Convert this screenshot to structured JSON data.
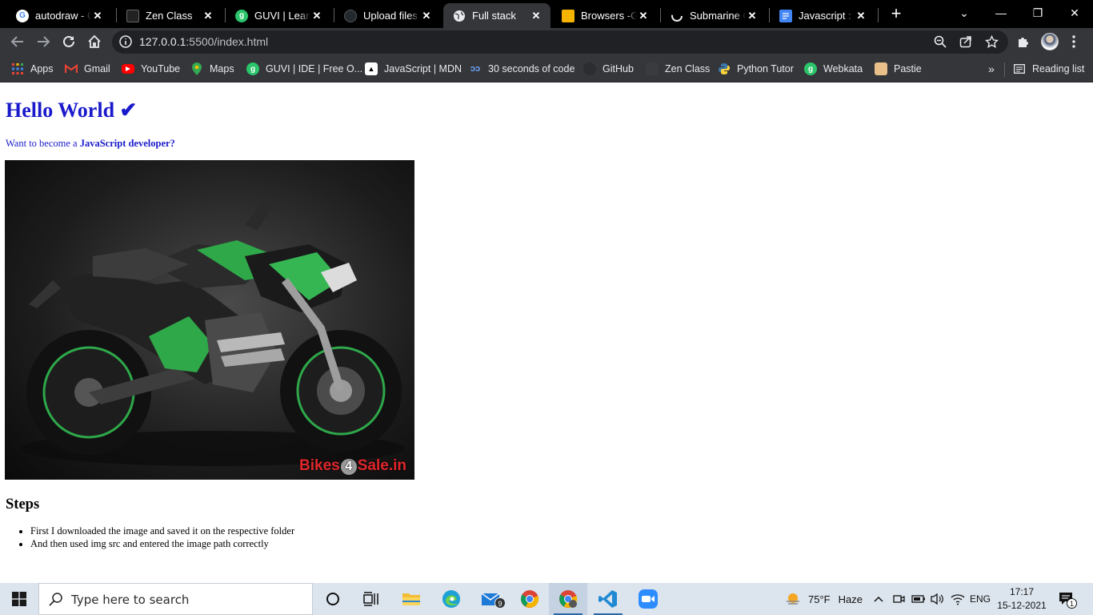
{
  "browser": {
    "tabs": [
      {
        "title": "autodraw - Go",
        "icon": "google-g-icon"
      },
      {
        "title": "Zen Class",
        "icon": "zen-class-icon"
      },
      {
        "title": "GUVI | Learn to",
        "icon": "guvi-icon"
      },
      {
        "title": "Upload files ·",
        "icon": "github-icon"
      },
      {
        "title": "Full stack",
        "icon": "globe-icon",
        "active": true
      },
      {
        "title": "Browsers -Get",
        "icon": "slides-icon"
      },
      {
        "title": "Submarine Ca",
        "icon": "loading-icon"
      },
      {
        "title": "Javascript : JS",
        "icon": "docs-icon"
      }
    ],
    "address": {
      "host": "127.0.0.1",
      "path": ":5500/index.html"
    },
    "bookmarks": [
      {
        "label": "Apps",
        "icon": "apps-grid-icon"
      },
      {
        "label": "Gmail",
        "icon": "gmail-icon"
      },
      {
        "label": "YouTube",
        "icon": "youtube-icon"
      },
      {
        "label": "Maps",
        "icon": "maps-icon"
      },
      {
        "label": "GUVI | IDE | Free O...",
        "icon": "guvi-icon"
      },
      {
        "label": "JavaScript | MDN",
        "icon": "mdn-icon"
      },
      {
        "label": "30 seconds of code",
        "icon": "30-seconds-icon"
      },
      {
        "label": "GitHub",
        "icon": "github-icon"
      },
      {
        "label": "Zen Class",
        "icon": "zen-class-icon"
      },
      {
        "label": "Python Tutor",
        "icon": "python-icon"
      },
      {
        "label": "Webkata",
        "icon": "guvi-icon"
      },
      {
        "label": "Pastie",
        "icon": "pastie-icon"
      }
    ],
    "overflow_label": "»",
    "reading_list_label": "Reading list"
  },
  "page": {
    "heading": "Hello World ✔",
    "intro_prefix": "Want to become a ",
    "intro_bold": "JavaScript developer?",
    "image_watermark_left": "Bikes",
    "image_watermark_num": "4",
    "image_watermark_right": "Sale.in",
    "steps_heading": "Steps",
    "steps": [
      "First I downloaded the image and saved it on the respective folder",
      "And then used img src and entered the image path correctly"
    ]
  },
  "taskbar": {
    "search_placeholder": "Type here to search",
    "mail_badge": "9",
    "weather": {
      "temp": "75°F",
      "condition": "Haze"
    },
    "language": "ENG",
    "time": "17:17",
    "date": "15-12-2021",
    "notification_count": "1"
  }
}
